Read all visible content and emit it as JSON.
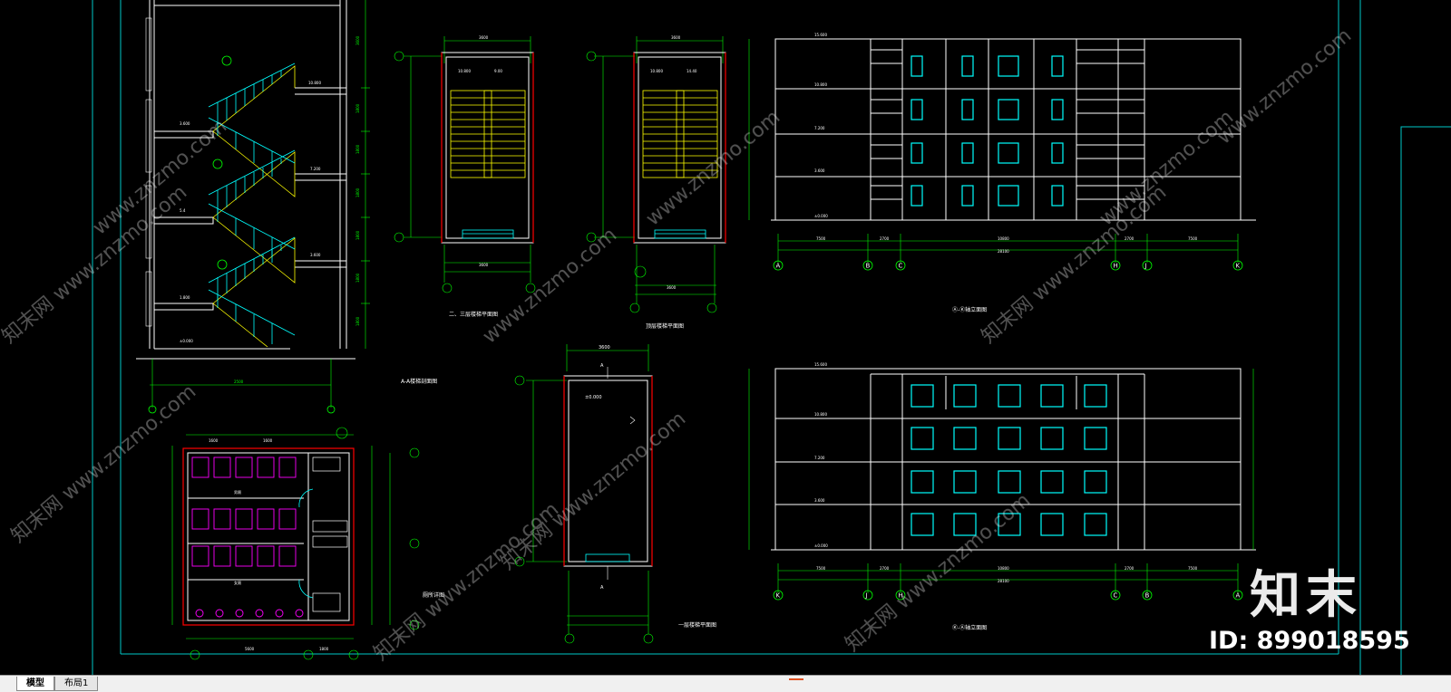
{
  "tabs": [
    {
      "label": "模型",
      "active": true
    },
    {
      "label": "布局1",
      "active": false
    }
  ],
  "watermark": {
    "logo_text": "知末",
    "id_text": "ID: 899018595",
    "repeat_text": "www.znzmo.com",
    "brand_text": "知末网"
  },
  "drawing_titles": {
    "stair_section": "A-A楼梯剖面图",
    "stair_plan_23": "二、三层楼梯平面图",
    "stair_plan_top": "顶层楼梯平面图",
    "toilet_plan": "厕所详图",
    "stair_plan_1": "一层楼梯平面图",
    "elev_ak": "Ⓐ-Ⓚ轴立面图",
    "elev_ka": "Ⓚ-Ⓐ轴立面图"
  },
  "grid_axes_elev1": [
    "A",
    "B",
    "C",
    "H",
    "J",
    "K"
  ],
  "grid_axes_elev2": [
    "K",
    "J",
    "H",
    "C",
    "B",
    "A"
  ],
  "colors": {
    "background": "#000000",
    "frame": "#00c8c8",
    "dim": "#00ff00",
    "wall": "#ffffff",
    "stair": "#ffff00",
    "rail": "#00ffff",
    "red": "#ff0000",
    "magenta": "#ff00ff"
  }
}
